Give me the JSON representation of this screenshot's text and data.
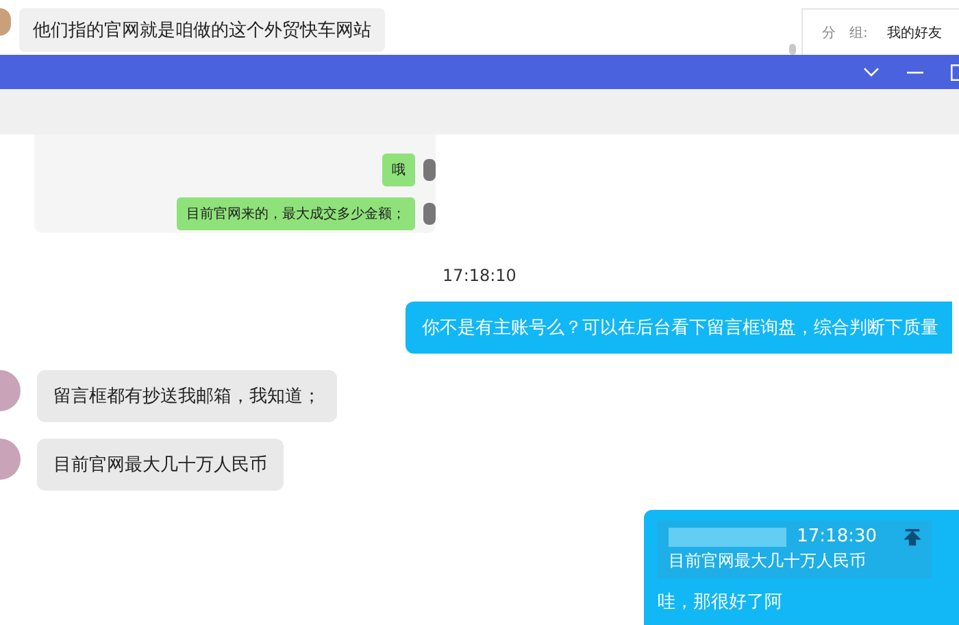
{
  "background_chat": {
    "message": "他们指的官网就是咱做的这个外贸快车网站"
  },
  "profile_panel": {
    "label": "分　组:",
    "value": "我的好友"
  },
  "messages": [
    {
      "kind": "screenshot",
      "bubbles": [
        "哦",
        "目前官网来的，最大成交多少金额；"
      ]
    },
    {
      "kind": "time",
      "text": "17:18:10"
    },
    {
      "kind": "sent",
      "text": "你不是有主账号么？可以在后台看下留言框询盘，综合判断下质量"
    },
    {
      "kind": "received",
      "text": "留言框都有抄送我邮箱，我知道；"
    },
    {
      "kind": "received",
      "text": "目前官网最大几十万人民币"
    },
    {
      "kind": "reply",
      "quote_time": "17:18:30",
      "quote_text": "目前官网最大几十万人民币",
      "text": "哇，那很好了阿"
    }
  ]
}
